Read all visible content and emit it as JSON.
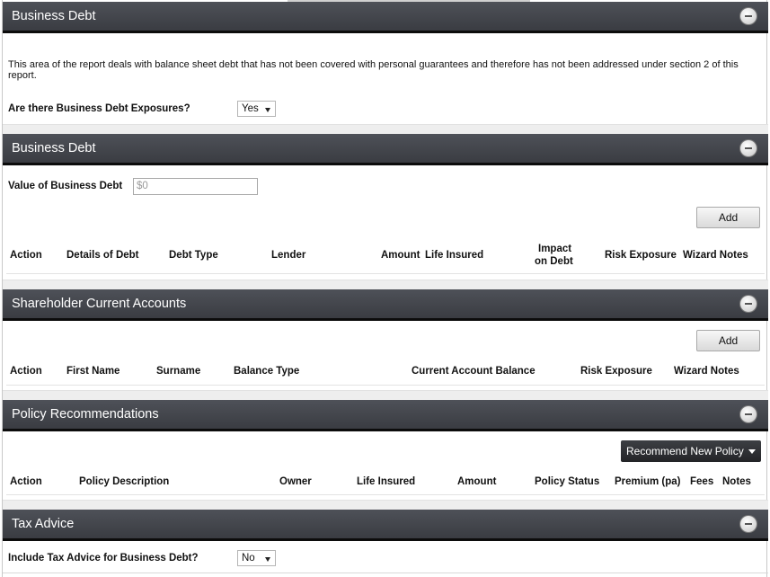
{
  "sections": {
    "s1": {
      "title": "Business Debt",
      "description": "This area of the report deals with balance sheet debt that has not been covered with personal guarantees and therefore has not been addressed under section 2 of this report.",
      "question_label": "Are there Business Debt Exposures?",
      "question_value": "Yes"
    },
    "s2": {
      "title": "Business Debt",
      "value_label": "Value of Business Debt",
      "value_placeholder": "$0",
      "add_label": "Add",
      "columns": [
        "Action",
        "Details of Debt",
        "Debt Type",
        "Lender",
        "Amount",
        "Life Insured",
        "Impact",
        "on Debt",
        "Risk Exposure",
        "Wizard Notes"
      ]
    },
    "s3": {
      "title": "Shareholder Current Accounts",
      "add_label": "Add",
      "columns": [
        "Action",
        "First Name",
        "Surname",
        "Balance Type",
        "Current Account Balance",
        "Risk Exposure",
        "Wizard Notes"
      ]
    },
    "s4": {
      "title": "Policy Recommendations",
      "recommend_label": "Recommend New Policy",
      "columns": [
        "Action",
        "Policy Description",
        "Owner",
        "Life Insured",
        "Amount",
        "Policy Status",
        "Premium (pa)",
        "Fees",
        "Notes"
      ]
    },
    "s5": {
      "title": "Tax Advice",
      "question_label": "Include Tax Advice for Business Debt?",
      "question_value": "No"
    }
  },
  "icons": {
    "collapse": "minus-circle-icon",
    "dropdown": "chevron-down-icon"
  },
  "colors": {
    "header_bg": "#45484e",
    "header_border": "#0c0c0c",
    "dark_button": "#2e3034"
  }
}
